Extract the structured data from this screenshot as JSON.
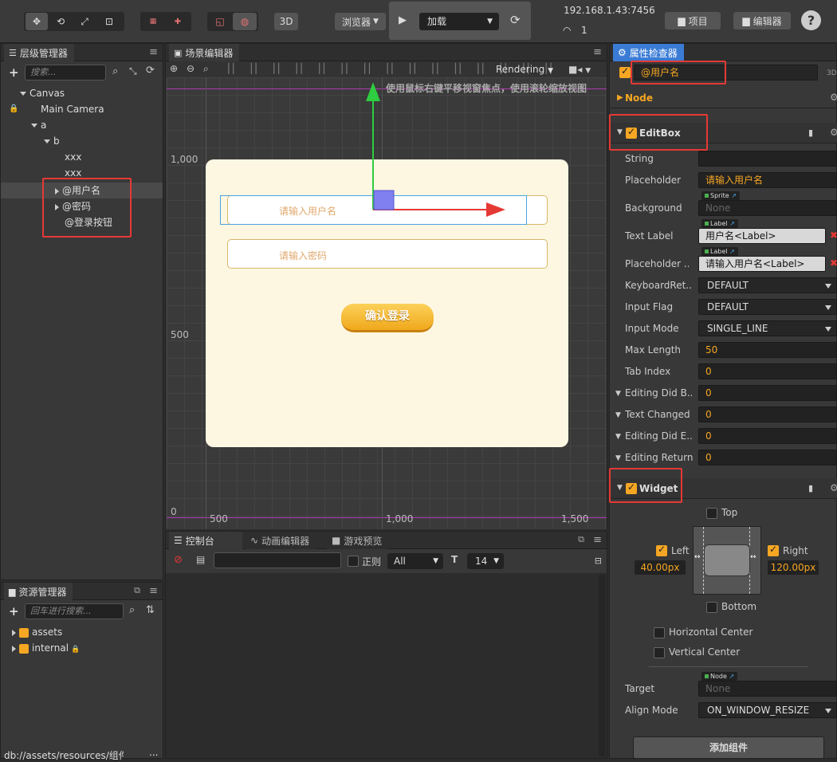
{
  "toolbar": {
    "btn_3d": "3D",
    "browser": "浏览器",
    "play_target": "加载",
    "ip": "192.168.1.43:7456",
    "wifi_count": "1",
    "project": "项目",
    "editor": "编辑器",
    "help": "?"
  },
  "hierarchy": {
    "title": "层级管理器",
    "search_placeholder": "搜索...",
    "items": [
      "Canvas",
      "Main Camera",
      "a",
      "b",
      "xxx",
      "xxx",
      "@用户名",
      "@密码",
      "@登录按钮"
    ]
  },
  "assets": {
    "title": "资源管理器",
    "search_placeholder": "回车进行搜索...",
    "items": [
      "assets",
      "internal"
    ],
    "path": "db://assets/resources/组件/",
    "more": "..."
  },
  "scene": {
    "title": "场景编辑器",
    "rendering": "Rendering",
    "hint": "使用鼠标右键平移视窗焦点，使用滚轮缩放视图",
    "y_labels": [
      "1,000",
      "500",
      "0"
    ],
    "x_labels": [
      "500",
      "1,000",
      "1,500"
    ],
    "username_placeholder": "请输入用户名",
    "password_placeholder": "请输入密码",
    "login_button": "确认登录"
  },
  "console": {
    "tabs": [
      "控制台",
      "动画编辑器",
      "游戏预览"
    ],
    "regex_label": "正则",
    "level": "All",
    "font_size": "14"
  },
  "inspector": {
    "title": "属性检查器",
    "node_name": "@用户名",
    "badge_3d": "3D",
    "node_section": "Node",
    "editbox": {
      "title": "EditBox",
      "rows": [
        {
          "label": "String",
          "value": ""
        },
        {
          "label": "Placeholder",
          "value": "请输入用户名"
        },
        {
          "label": "Background",
          "tag": "Sprite",
          "value": "None"
        },
        {
          "label": "Text Label",
          "tag": "Label",
          "value": "用户名<Label>"
        },
        {
          "label": "Placeholder ...",
          "tag": "Label",
          "value": "请输入用户名<Label>"
        },
        {
          "label": "KeyboardRet...",
          "value": "DEFAULT"
        },
        {
          "label": "Input Flag",
          "value": "DEFAULT"
        },
        {
          "label": "Input Mode",
          "value": "SINGLE_LINE"
        },
        {
          "label": "Max Length",
          "value": "50"
        },
        {
          "label": "Tab Index",
          "value": "0"
        },
        {
          "label": "Editing Did B...",
          "value": "0"
        },
        {
          "label": "Text Changed",
          "value": "0"
        },
        {
          "label": "Editing Did E...",
          "value": "0"
        },
        {
          "label": "Editing Return",
          "value": "0"
        }
      ]
    },
    "widget": {
      "title": "Widget",
      "top": "Top",
      "left": "Left",
      "left_value": "40.00px",
      "right": "Right",
      "right_value": "120.00px",
      "bottom": "Bottom",
      "horizontal_center": "Horizontal Center",
      "vertical_center": "Vertical Center",
      "target_label": "Target",
      "target_tag": "Node",
      "target_value": "None",
      "align_mode_label": "Align Mode",
      "align_mode_value": "ON_WINDOW_RESIZE"
    },
    "add_component": "添加组件"
  }
}
